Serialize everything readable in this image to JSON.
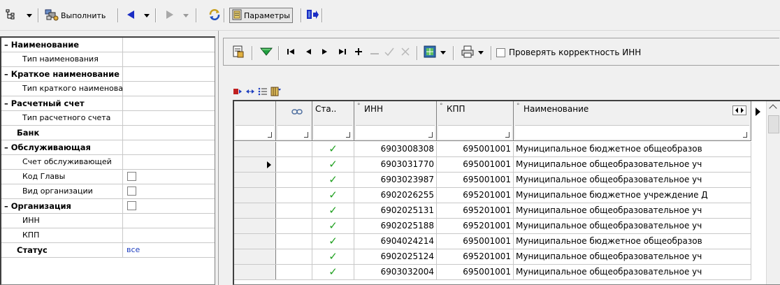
{
  "toolbar": {
    "tree_icon": "tree-layout-icon",
    "execute_label": "Выполнить",
    "execute_icon": "execute-icon",
    "back_icon": "back-arrow-icon",
    "forward_icon": "forward-arrow-icon",
    "refresh_icon": "refresh-icon",
    "params_label": "Параметры",
    "params_icon": "parameters-icon",
    "exit_icon": "exit-icon"
  },
  "properties": [
    {
      "kind": "group",
      "label": "– Наименование",
      "value": ""
    },
    {
      "kind": "child",
      "label": "Тип наименования",
      "value": ""
    },
    {
      "kind": "group",
      "label": "– Краткое наименование",
      "value": ""
    },
    {
      "kind": "child",
      "label": "Тип краткого наименования",
      "value": ""
    },
    {
      "kind": "group",
      "label": "– Расчетный счет",
      "value": ""
    },
    {
      "kind": "child",
      "label": "Тип расчетного счета",
      "value": ""
    },
    {
      "kind": "plain",
      "label": "Банк",
      "value": ""
    },
    {
      "kind": "group",
      "label": "– Обслуживающая",
      "value": ""
    },
    {
      "kind": "child",
      "label": "Счет обслуживающей",
      "value": ""
    },
    {
      "kind": "child-check",
      "label": "Код Главы",
      "value": ""
    },
    {
      "kind": "child-check",
      "label": "Вид организации",
      "value": ""
    },
    {
      "kind": "group-check",
      "label": "– Организация",
      "value": ""
    },
    {
      "kind": "child",
      "label": "ИНН",
      "value": ""
    },
    {
      "kind": "child",
      "label": "КПП",
      "value": ""
    },
    {
      "kind": "plain",
      "label": "Статус",
      "value": "все"
    }
  ],
  "right_toolbar": {
    "check_inn_label": "Проверять корректность ИНН",
    "check_inn_checked": false
  },
  "grid": {
    "columns": [
      "",
      "",
      "Ста..",
      "ИНН",
      "КПП",
      "Наименование"
    ],
    "selected_row": 1,
    "rows": [
      {
        "status": "ok",
        "inn": "6903008308",
        "kpp": "695001001",
        "name": "Муниципальное бюджетное общеобразов"
      },
      {
        "status": "ok",
        "inn": "6903031770",
        "kpp": "695001001",
        "name": "Муниципальное общеобразовательное уч"
      },
      {
        "status": "ok",
        "inn": "6903023987",
        "kpp": "695001001",
        "name": "Муниципальное общеобразовательное уч"
      },
      {
        "status": "ok",
        "inn": "6902026255",
        "kpp": "695201001",
        "name": "Муниципальное бюджетное учреждение Д"
      },
      {
        "status": "ok",
        "inn": "6902025131",
        "kpp": "695201001",
        "name": "Муниципальное общеобразовательное уч"
      },
      {
        "status": "ok",
        "inn": "6902025188",
        "kpp": "695201001",
        "name": "Муниципальное общеобразовательное уч"
      },
      {
        "status": "ok",
        "inn": "6904024214",
        "kpp": "695001001",
        "name": "Муниципальное бюджетное общеобразов"
      },
      {
        "status": "ok",
        "inn": "6902025124",
        "kpp": "695201001",
        "name": "Муниципальное общеобразовательное уч"
      },
      {
        "status": "ok",
        "inn": "6903032004",
        "kpp": "695001001",
        "name": "Муниципальное общеобразовательное уч"
      }
    ]
  }
}
